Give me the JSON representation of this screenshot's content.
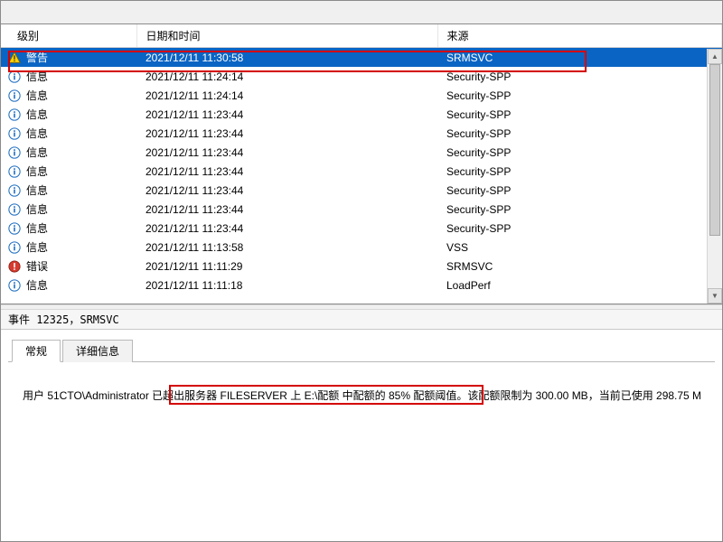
{
  "columns": {
    "level": "级别",
    "datetime": "日期和时间",
    "source": "来源"
  },
  "rows": [
    {
      "icon": "warning",
      "level": "警告",
      "datetime": "2021/12/11 11:30:58",
      "source": "SRMSVC",
      "selected": true
    },
    {
      "icon": "info",
      "level": "信息",
      "datetime": "2021/12/11 11:24:14",
      "source": "Security-SPP"
    },
    {
      "icon": "info",
      "level": "信息",
      "datetime": "2021/12/11 11:24:14",
      "source": "Security-SPP"
    },
    {
      "icon": "info",
      "level": "信息",
      "datetime": "2021/12/11 11:23:44",
      "source": "Security-SPP"
    },
    {
      "icon": "info",
      "level": "信息",
      "datetime": "2021/12/11 11:23:44",
      "source": "Security-SPP"
    },
    {
      "icon": "info",
      "level": "信息",
      "datetime": "2021/12/11 11:23:44",
      "source": "Security-SPP"
    },
    {
      "icon": "info",
      "level": "信息",
      "datetime": "2021/12/11 11:23:44",
      "source": "Security-SPP"
    },
    {
      "icon": "info",
      "level": "信息",
      "datetime": "2021/12/11 11:23:44",
      "source": "Security-SPP"
    },
    {
      "icon": "info",
      "level": "信息",
      "datetime": "2021/12/11 11:23:44",
      "source": "Security-SPP"
    },
    {
      "icon": "info",
      "level": "信息",
      "datetime": "2021/12/11 11:23:44",
      "source": "Security-SPP"
    },
    {
      "icon": "info",
      "level": "信息",
      "datetime": "2021/12/11 11:13:58",
      "source": "VSS"
    },
    {
      "icon": "error",
      "level": "错误",
      "datetime": "2021/12/11 11:11:29",
      "source": "SRMSVC"
    },
    {
      "icon": "info",
      "level": "信息",
      "datetime": "2021/12/11 11:11:18",
      "source": "LoadPerf"
    }
  ],
  "status_bar": "事件 12325，SRMSVC",
  "tabs": {
    "general": "常规",
    "details": "详细信息"
  },
  "detail_message": "用户 51CTO\\Administrator 已超出服务器 FILESERVER 上 E:\\配额 中配额的 85% 配额阈值。该配额限制为 300.00 MB，当前已使用 298.75 M",
  "colors": {
    "selected_bg": "#0a64c4",
    "highlight_border": "#d40000"
  }
}
